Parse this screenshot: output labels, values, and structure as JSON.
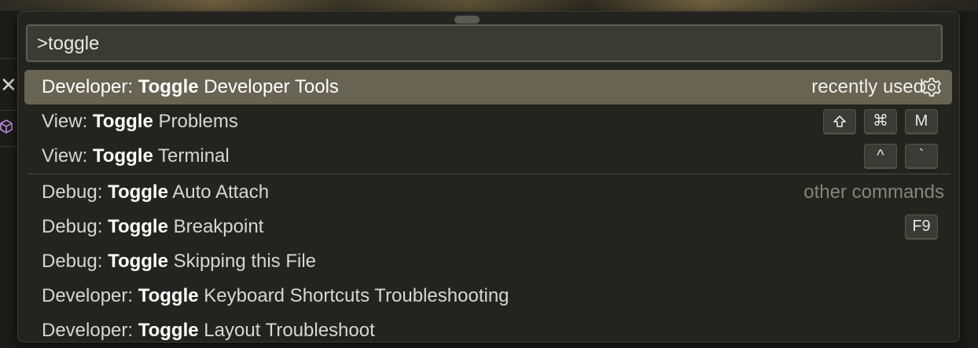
{
  "quick_open": {
    "input_value": ">toggle"
  },
  "commands": [
    {
      "prefix": "Developer: ",
      "match": "Toggle",
      "rest": " Developer Tools",
      "tag": "recently used",
      "keys": [],
      "icon": "gear-icon"
    },
    {
      "prefix": "View: ",
      "match": "Toggle",
      "rest": " Problems",
      "tag": "",
      "keys": [
        "⇧",
        "⌘",
        "M"
      ]
    },
    {
      "prefix": "View: ",
      "match": "Toggle",
      "rest": " Terminal",
      "tag": "",
      "keys": [
        "^",
        "`"
      ]
    },
    {
      "prefix": "Debug: ",
      "match": "Toggle",
      "rest": " Auto Attach",
      "tag": "other commands",
      "keys": []
    },
    {
      "prefix": "Debug: ",
      "match": "Toggle",
      "rest": " Breakpoint",
      "tag": "",
      "keys": [
        "F9"
      ]
    },
    {
      "prefix": "Debug: ",
      "match": "Toggle",
      "rest": " Skipping this File",
      "tag": "",
      "keys": []
    },
    {
      "prefix": "Developer: ",
      "match": "Toggle",
      "rest": " Keyboard Shortcuts Troubleshooting",
      "tag": "",
      "keys": []
    },
    {
      "prefix": "Developer: ",
      "match": "Toggle",
      "rest": " Layout Troubleshoot",
      "tag": "",
      "keys": []
    }
  ],
  "background": {
    "close_glyph": "✕"
  },
  "colors": {
    "selection": "#676453",
    "palette_bg": "#232320",
    "input_border": "#5f5f54"
  }
}
